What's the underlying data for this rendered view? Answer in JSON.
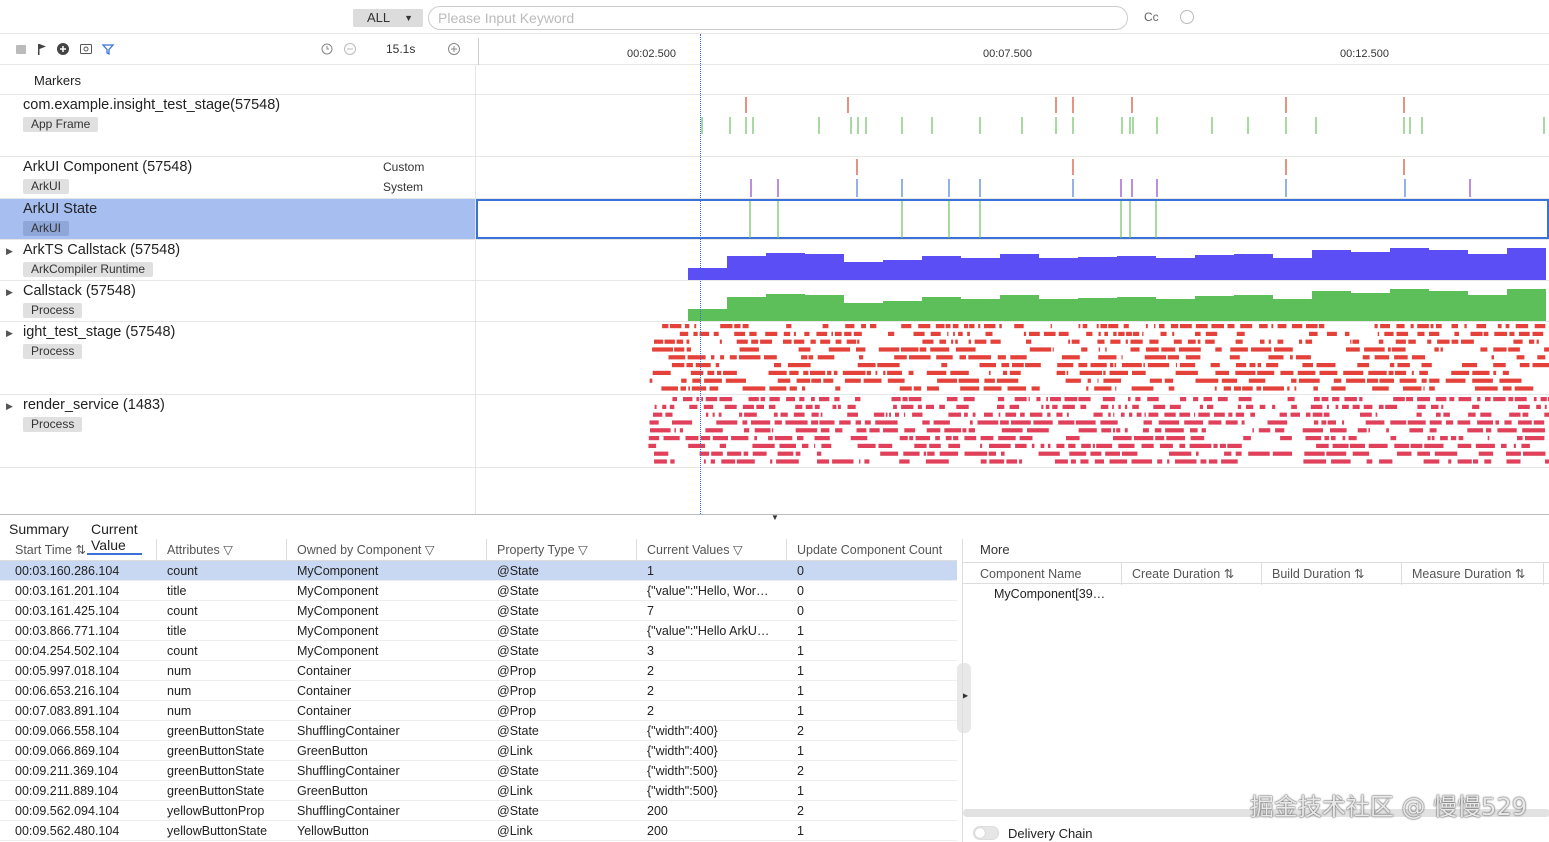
{
  "search": {
    "scope": "ALL",
    "placeholder": "Please Input Keyword",
    "case_label": "Cc"
  },
  "toolbar": {
    "zoom_value": "15.1s"
  },
  "ruler": {
    "ticks": [
      "00:02.500",
      "00:07.500",
      "00:12.500"
    ]
  },
  "lanes": {
    "markers": {
      "name": "Markers"
    },
    "app_frame": {
      "name": "com.example.insight_test_stage(57548)",
      "tag": "App Frame"
    },
    "arkui_component": {
      "name": "ArkUI Component (57548)",
      "tag": "ArkUI",
      "sub1": "Custom",
      "sub2": "System"
    },
    "arkui_state": {
      "name": "ArkUI State",
      "tag": "ArkUI"
    },
    "arkts_callstack": {
      "name": "ArkTS Callstack (57548)",
      "tag": "ArkCompiler Runtime"
    },
    "callstack": {
      "name": "Callstack (57548)",
      "tag": "Process"
    },
    "test_stage": {
      "name": "ight_test_stage (57548)",
      "tag": "Process"
    },
    "render_service": {
      "name": "render_service (1483)",
      "tag": "Process"
    }
  },
  "colors": {
    "accent": "#3b72d8",
    "selected_lane": "#a6bff0",
    "arkts": "#5b4ef5",
    "callstack": "#5cbf5a",
    "thread": "#e4413a",
    "render": "#e0405a",
    "marker_red": "#d9482e",
    "marker_green": "#6cc261",
    "marker_blue": "#4a7fd8",
    "marker_purple": "#8e44c8"
  },
  "bottom": {
    "tabs": [
      "Summary",
      "Current Value"
    ],
    "columns": [
      "Start Time",
      "Attributes",
      "Owned by Component",
      "Property Type",
      "Current Values",
      "Update Component Count"
    ],
    "rows": [
      [
        "00:03.160.286.104",
        "count",
        "MyComponent",
        "@State",
        "1",
        "0"
      ],
      [
        "00:03.161.201.104",
        "title",
        "MyComponent",
        "@State",
        "{\"value\":\"Hello, Wor…",
        "0"
      ],
      [
        "00:03.161.425.104",
        "count",
        "MyComponent",
        "@State",
        "7",
        "0"
      ],
      [
        "00:03.866.771.104",
        "title",
        "MyComponent",
        "@State",
        "{\"value\":\"Hello ArkU…",
        "1"
      ],
      [
        "00:04.254.502.104",
        "count",
        "MyComponent",
        "@State",
        "3",
        "1"
      ],
      [
        "00:05.997.018.104",
        "num",
        "Container",
        "@Prop",
        "2",
        "1"
      ],
      [
        "00:06.653.216.104",
        "num",
        "Container",
        "@Prop",
        "2",
        "1"
      ],
      [
        "00:07.083.891.104",
        "num",
        "Container",
        "@Prop",
        "2",
        "1"
      ],
      [
        "00:09.066.558.104",
        "greenButtonState",
        "ShufflingContainer",
        "@State",
        "{\"width\":400}",
        "2"
      ],
      [
        "00:09.066.869.104",
        "greenButtonState",
        "GreenButton",
        "@Link",
        "{\"width\":400}",
        "1"
      ],
      [
        "00:09.211.369.104",
        "greenButtonState",
        "ShufflingContainer",
        "@State",
        "{\"width\":500}",
        "2"
      ],
      [
        "00:09.211.889.104",
        "greenButtonState",
        "GreenButton",
        "@Link",
        "{\"width\":500}",
        "1"
      ],
      [
        "00:09.562.094.104",
        "yellowButtonProp",
        "ShufflingContainer",
        "@State",
        "200",
        "2"
      ],
      [
        "00:09.562.480.104",
        "yellowButtonState",
        "YellowButton",
        "@Link",
        "200",
        "1"
      ]
    ],
    "more": {
      "title": "More",
      "columns": [
        "Component Name",
        "Create Duration",
        "Build Duration",
        "Measure Duration"
      ],
      "row": "MyComponent[39…",
      "delivery_chain": "Delivery Chain"
    }
  },
  "watermark": "掘金技术社区 @ 慢慢529"
}
